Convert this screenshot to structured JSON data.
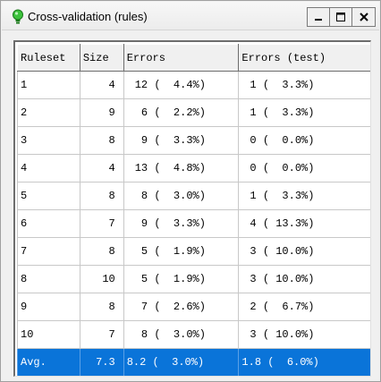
{
  "window": {
    "title": "Cross-validation (rules)",
    "icon": "lightbulb-icon",
    "buttons": [
      "minimize-icon",
      "maximize-icon",
      "close-icon"
    ]
  },
  "table": {
    "columns": [
      "Ruleset",
      "Size",
      "Errors",
      "Errors (test)"
    ],
    "rows": [
      {
        "ruleset": "1",
        "size": "4",
        "errors": "12 (  4.4%)",
        "errors_test": "1 (  3.3%)"
      },
      {
        "ruleset": "2",
        "size": "9",
        "errors": " 6 (  2.2%)",
        "errors_test": "1 (  3.3%)"
      },
      {
        "ruleset": "3",
        "size": "8",
        "errors": " 9 (  3.3%)",
        "errors_test": "0 (  0.0%)"
      },
      {
        "ruleset": "4",
        "size": "4",
        "errors": "13 (  4.8%)",
        "errors_test": "0 (  0.0%)"
      },
      {
        "ruleset": "5",
        "size": "8",
        "errors": " 8 (  3.0%)",
        "errors_test": "1 (  3.3%)"
      },
      {
        "ruleset": "6",
        "size": "7",
        "errors": " 9 (  3.3%)",
        "errors_test": "4 ( 13.3%)"
      },
      {
        "ruleset": "7",
        "size": "8",
        "errors": " 5 (  1.9%)",
        "errors_test": "3 ( 10.0%)"
      },
      {
        "ruleset": "8",
        "size": "10",
        "errors": " 5 (  1.9%)",
        "errors_test": "3 ( 10.0%)"
      },
      {
        "ruleset": "9",
        "size": "8",
        "errors": " 7 (  2.6%)",
        "errors_test": "2 (  6.7%)"
      },
      {
        "ruleset": "10",
        "size": "7",
        "errors": " 8 (  3.0%)",
        "errors_test": "3 ( 10.0%)"
      }
    ],
    "average": {
      "ruleset": "Avg.",
      "size": "7.3",
      "errors": "8.2 (  3.0%)",
      "errors_test": "1.8 (  6.0%)"
    }
  },
  "colors": {
    "selection": "#0a74d9",
    "icon_green": "#2eae2e"
  }
}
